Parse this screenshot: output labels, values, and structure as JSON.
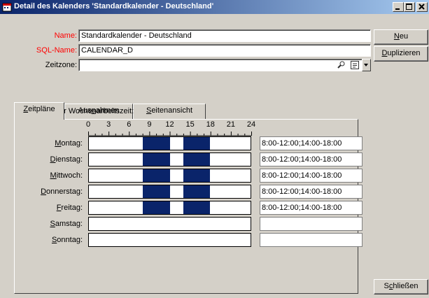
{
  "window": {
    "title": "Detail des Kalenders 'Standardkalender - Deutschland'"
  },
  "form": {
    "name_label": "Name:",
    "name_value": "Standardkalender - Deutschland",
    "sql_label": "SQL-Name:",
    "sql_value": "CALENDAR_D",
    "zone_label": "Zeitzone:",
    "zone_value": ""
  },
  "buttons": {
    "new": {
      "u": "N",
      "rest": "eu"
    },
    "duplicate": {
      "u": "D",
      "rest": "uplizieren"
    },
    "close": {
      "pre": "S",
      "u": "c",
      "rest": "hließen"
    }
  },
  "tabs": [
    {
      "u": "Z",
      "pre": "",
      "rest": "eitpläne"
    },
    {
      "pre": "Aus",
      "u": "n",
      "rest": "ahmen"
    },
    {
      "pre": "",
      "u": "S",
      "rest": "eitenansicht"
    }
  ],
  "schedule": {
    "heading": "Definition der Wochenarbeitszeit:",
    "hours": [
      "0",
      "3",
      "6",
      "9",
      "12",
      "15",
      "18",
      "21",
      "24"
    ],
    "days": [
      {
        "u": "M",
        "rest": "ontag:",
        "time": "8:00-12:00;14:00-18:00",
        "ranges": [
          [
            8,
            12
          ],
          [
            14,
            18
          ]
        ]
      },
      {
        "u": "D",
        "rest": "ienstag:",
        "time": "8:00-12:00;14:00-18:00",
        "ranges": [
          [
            8,
            12
          ],
          [
            14,
            18
          ]
        ]
      },
      {
        "u": "M",
        "rest": "ittwoch:",
        "time": "8:00-12:00;14:00-18:00",
        "ranges": [
          [
            8,
            12
          ],
          [
            14,
            18
          ]
        ]
      },
      {
        "u": "D",
        "rest": "onnerstag:",
        "time": "8:00-12:00;14:00-18:00",
        "ranges": [
          [
            8,
            12
          ],
          [
            14,
            18
          ]
        ]
      },
      {
        "u": "F",
        "rest": "reitag:",
        "time": "8:00-12:00;14:00-18:00",
        "ranges": [
          [
            8,
            12
          ],
          [
            14,
            18
          ]
        ]
      },
      {
        "u": "S",
        "rest": "amstag:",
        "time": "",
        "ranges": []
      },
      {
        "u": "S",
        "rest": "onntag:",
        "time": "",
        "ranges": []
      }
    ]
  }
}
